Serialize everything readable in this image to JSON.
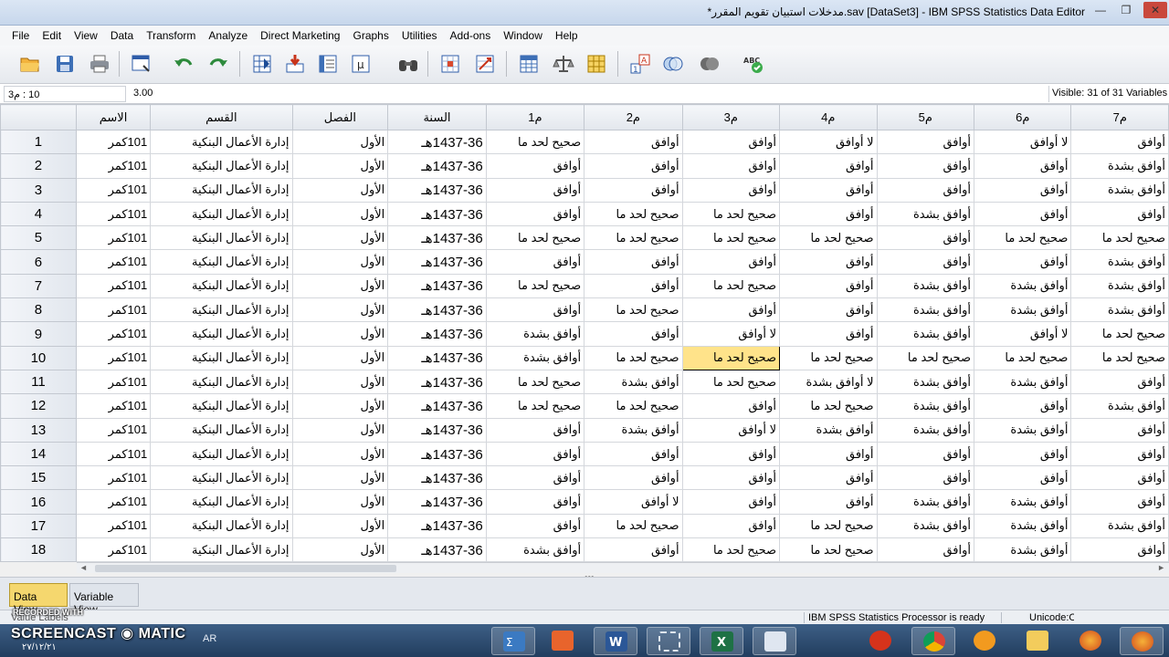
{
  "window": {
    "title": "*مدخلات استبيان تقويم المقرر.sav [DataSet3] - IBM SPSS Statistics Data Editor",
    "min": "—",
    "max": "❐",
    "close": "✕"
  },
  "menu": [
    "File",
    "Edit",
    "View",
    "Data",
    "Transform",
    "Analyze",
    "Direct Marketing",
    "Graphs",
    "Utilities",
    "Add-ons",
    "Window",
    "Help"
  ],
  "toolbar": {
    "icons": [
      "open-icon",
      "save-icon",
      "print-icon",
      "recall-dialog-icon",
      "undo-icon",
      "redo-icon",
      "goto-case-icon",
      "goto-variable-icon",
      "variables-icon",
      "run-descriptives-icon",
      "find-icon",
      "insert-cases-icon",
      "insert-variable-icon",
      "split-file-icon",
      "weight-cases-icon",
      "select-cases-icon",
      "value-labels-icon",
      "use-sets-icon",
      "show-all-variables-icon",
      "spell-check-icon"
    ]
  },
  "editbar": {
    "cell_ref": "10 : م3",
    "cell_value": "3.00",
    "visible": "Visible: 31 of 31 Variables"
  },
  "grid": {
    "columns": [
      "الاسم",
      "القسم",
      "الفصل",
      "السنة",
      "م1",
      "م2",
      "م3",
      "م4",
      "م5",
      "م6",
      "م7"
    ],
    "selected": {
      "row": 10,
      "col": "م3"
    },
    "rows": [
      {
        "n": "1",
        "cells": [
          "101كمر",
          "إدارة الأعمال البنكية",
          "الأول",
          "1437-36هـ",
          "صحيح لحد ما",
          "أوافق",
          "أوافق",
          "لا أوافق",
          "أوافق",
          "لا أوافق",
          "أوافق"
        ]
      },
      {
        "n": "2",
        "cells": [
          "101كمر",
          "إدارة الأعمال البنكية",
          "الأول",
          "1437-36هـ",
          "أوافق",
          "أوافق",
          "أوافق",
          "أوافق",
          "أوافق",
          "أوافق",
          "أوافق بشدة"
        ]
      },
      {
        "n": "3",
        "cells": [
          "101كمر",
          "إدارة الأعمال البنكية",
          "الأول",
          "1437-36هـ",
          "أوافق",
          "أوافق",
          "أوافق",
          "أوافق",
          "أوافق",
          "أوافق",
          "أوافق بشدة"
        ]
      },
      {
        "n": "4",
        "cells": [
          "101كمر",
          "إدارة الأعمال البنكية",
          "الأول",
          "1437-36هـ",
          "أوافق",
          "صحيح لحد ما",
          "صحيح لحد ما",
          "أوافق",
          "أوافق بشدة",
          "أوافق",
          "أوافق"
        ]
      },
      {
        "n": "5",
        "cells": [
          "101كمر",
          "إدارة الأعمال البنكية",
          "الأول",
          "1437-36هـ",
          "صحيح لحد ما",
          "صحيح لحد ما",
          "صحيح لحد ما",
          "صحيح لحد ما",
          "أوافق",
          "صحيح لحد ما",
          "صحيح لحد ما"
        ]
      },
      {
        "n": "6",
        "cells": [
          "101كمر",
          "إدارة الأعمال البنكية",
          "الأول",
          "1437-36هـ",
          "أوافق",
          "أوافق",
          "أوافق",
          "أوافق",
          "أوافق",
          "أوافق",
          "أوافق بشدة"
        ]
      },
      {
        "n": "7",
        "cells": [
          "101كمر",
          "إدارة الأعمال البنكية",
          "الأول",
          "1437-36هـ",
          "صحيح لحد ما",
          "أوافق",
          "صحيح لحد ما",
          "أوافق",
          "أوافق بشدة",
          "أوافق بشدة",
          "أوافق بشدة"
        ]
      },
      {
        "n": "8",
        "cells": [
          "101كمر",
          "إدارة الأعمال البنكية",
          "الأول",
          "1437-36هـ",
          "أوافق",
          "صحيح لحد ما",
          "أوافق",
          "أوافق",
          "أوافق بشدة",
          "أوافق بشدة",
          "أوافق بشدة"
        ]
      },
      {
        "n": "9",
        "cells": [
          "101كمر",
          "إدارة الأعمال البنكية",
          "الأول",
          "1437-36هـ",
          "أوافق بشدة",
          "أوافق",
          "لا أوافق",
          "أوافق",
          "أوافق بشدة",
          "لا أوافق",
          "صحيح لحد ما"
        ]
      },
      {
        "n": "10",
        "cells": [
          "101كمر",
          "إدارة الأعمال البنكية",
          "الأول",
          "1437-36هـ",
          "أوافق بشدة",
          "صحيح لحد ما",
          "صحيح لحد ما",
          "صحيح لحد ما",
          "صحيح لحد ما",
          "صحيح لحد ما",
          "صحيح لحد ما"
        ]
      },
      {
        "n": "11",
        "cells": [
          "101كمر",
          "إدارة الأعمال البنكية",
          "الأول",
          "1437-36هـ",
          "صحيح لحد ما",
          "أوافق بشدة",
          "صحيح لحد ما",
          "لا أوافق بشدة",
          "أوافق بشدة",
          "أوافق بشدة",
          "أوافق"
        ]
      },
      {
        "n": "12",
        "cells": [
          "101كمر",
          "إدارة الأعمال البنكية",
          "الأول",
          "1437-36هـ",
          "صحيح لحد ما",
          "صحيح لحد ما",
          "أوافق",
          "صحيح لحد ما",
          "أوافق بشدة",
          "أوافق",
          "أوافق بشدة"
        ]
      },
      {
        "n": "13",
        "cells": [
          "101كمر",
          "إدارة الأعمال البنكية",
          "الأول",
          "1437-36هـ",
          "أوافق",
          "أوافق بشدة",
          "لا أوافق",
          "أوافق بشدة",
          "أوافق بشدة",
          "أوافق بشدة",
          "أوافق"
        ]
      },
      {
        "n": "14",
        "cells": [
          "101كمر",
          "إدارة الأعمال البنكية",
          "الأول",
          "1437-36هـ",
          "أوافق",
          "أوافق",
          "أوافق",
          "أوافق",
          "أوافق",
          "أوافق",
          "أوافق"
        ]
      },
      {
        "n": "15",
        "cells": [
          "101كمر",
          "إدارة الأعمال البنكية",
          "الأول",
          "1437-36هـ",
          "أوافق",
          "أوافق",
          "أوافق",
          "أوافق",
          "أوافق",
          "أوافق",
          "أوافق"
        ]
      },
      {
        "n": "16",
        "cells": [
          "101كمر",
          "إدارة الأعمال البنكية",
          "الأول",
          "1437-36هـ",
          "أوافق",
          "لا أوافق",
          "أوافق",
          "أوافق",
          "أوافق بشدة",
          "أوافق بشدة",
          "أوافق"
        ]
      },
      {
        "n": "17",
        "cells": [
          "101كمر",
          "إدارة الأعمال البنكية",
          "الأول",
          "1437-36هـ",
          "أوافق",
          "صحيح لحد ما",
          "أوافق",
          "صحيح لحد ما",
          "أوافق بشدة",
          "أوافق بشدة",
          "أوافق بشدة"
        ]
      },
      {
        "n": "18",
        "cells": [
          "101كمر",
          "إدارة الأعمال البنكية",
          "الأول",
          "1437-36هـ",
          "أوافق بشدة",
          "أوافق",
          "صحيح لحد ما",
          "صحيح لحد ما",
          "أوافق",
          "أوافق بشدة",
          "أوافق"
        ]
      }
    ]
  },
  "tabs": {
    "data_view": "Data View",
    "variable_view": "Variable View"
  },
  "status": {
    "processor": "IBM SPSS Statistics Processor is ready",
    "unicode": "Unicode:ON",
    "label": "Value Labels"
  },
  "watermark": {
    "recorded": "RECORDED WITH",
    "brand": "SCREENCAST ◉ MATIC",
    "date": "٢٧/١٢/٢١"
  },
  "taskbar": {
    "lang": "AR",
    "apps": [
      "spss-task-icon",
      "pdf-task-icon",
      "word-task-icon",
      "snipping-task-icon",
      "excel-task-icon",
      "windows-explorer-task-icon",
      "media-task-icon",
      "chrome-task-icon",
      "music-task-icon",
      "folder-task-icon",
      "firefox-task-icon"
    ]
  },
  "colors": {
    "selection": "#ffe38a",
    "active_tab": "#f5d76e",
    "taskbar": "#2e4d72"
  }
}
